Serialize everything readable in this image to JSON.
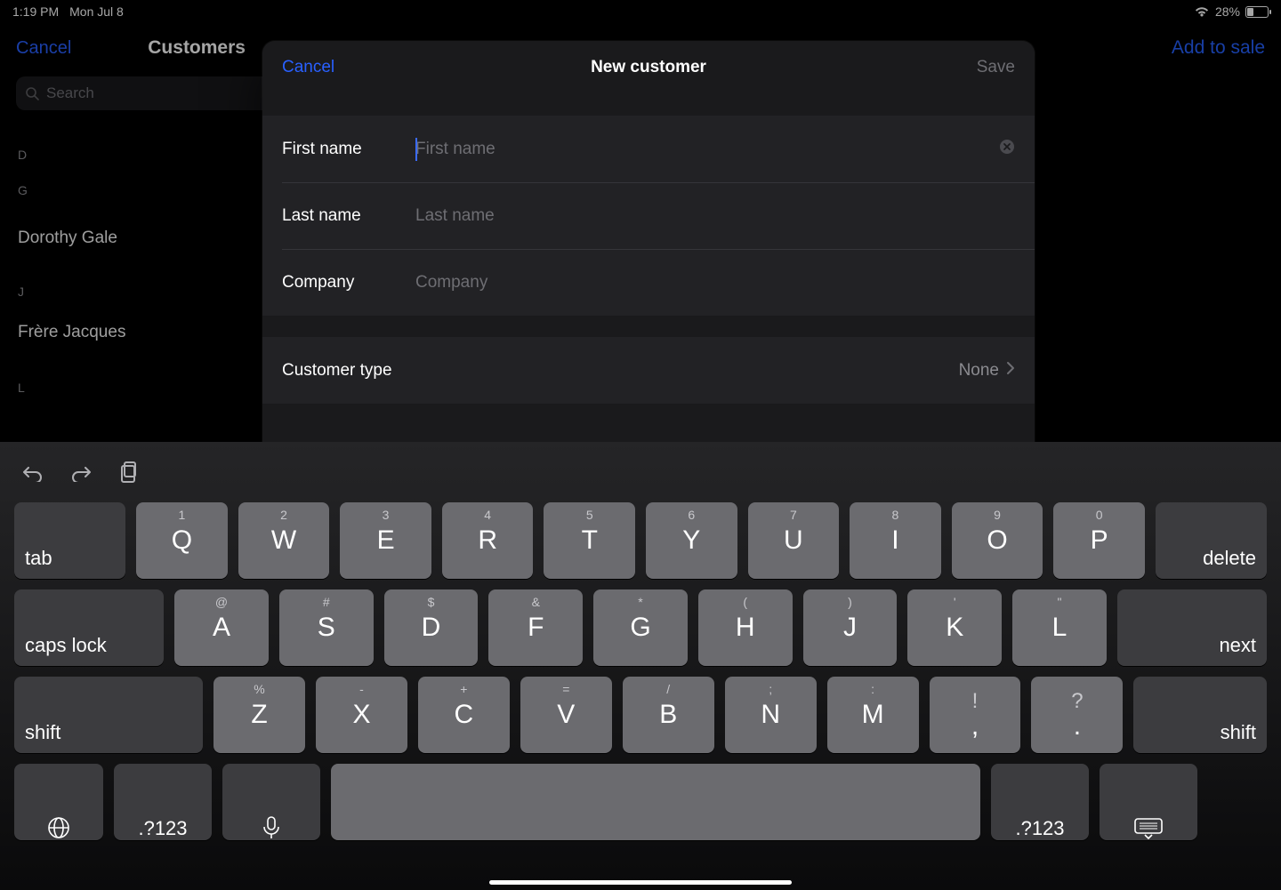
{
  "status": {
    "time": "1:19 PM",
    "date": "Mon Jul 8",
    "battery_pct": "28%"
  },
  "toolbar": {
    "cancel": "Cancel",
    "title": "Customers",
    "add": "Add to sale"
  },
  "search": {
    "placeholder": "Search"
  },
  "sections": {
    "d": "D",
    "g": "G",
    "j": "J",
    "l": "L"
  },
  "customers": {
    "dorothy": "Dorothy Gale",
    "frere": "Frère Jacques"
  },
  "modal": {
    "cancel": "Cancel",
    "title": "New customer",
    "save": "Save",
    "first_label": "First name",
    "first_ph": "First name",
    "last_label": "Last name",
    "last_ph": "Last name",
    "company_label": "Company",
    "company_ph": "Company",
    "ctype_label": "Customer type",
    "ctype_value": "None"
  },
  "keys": {
    "tab": "tab",
    "delete": "delete",
    "caps": "caps lock",
    "next": "next",
    "shift": "shift",
    "numsym": ".?123",
    "r1": [
      {
        "main": "Q",
        "hint": "1"
      },
      {
        "main": "W",
        "hint": "2"
      },
      {
        "main": "E",
        "hint": "3"
      },
      {
        "main": "R",
        "hint": "4"
      },
      {
        "main": "T",
        "hint": "5"
      },
      {
        "main": "Y",
        "hint": "6"
      },
      {
        "main": "U",
        "hint": "7"
      },
      {
        "main": "I",
        "hint": "8"
      },
      {
        "main": "O",
        "hint": "9"
      },
      {
        "main": "P",
        "hint": "0"
      }
    ],
    "r2": [
      {
        "main": "A",
        "hint": "@"
      },
      {
        "main": "S",
        "hint": "#"
      },
      {
        "main": "D",
        "hint": "$"
      },
      {
        "main": "F",
        "hint": "&"
      },
      {
        "main": "G",
        "hint": "*"
      },
      {
        "main": "H",
        "hint": "("
      },
      {
        "main": "J",
        "hint": ")"
      },
      {
        "main": "K",
        "hint": "'"
      },
      {
        "main": "L",
        "hint": "\""
      }
    ],
    "r3": [
      {
        "main": "Z",
        "hint": "%"
      },
      {
        "main": "X",
        "hint": "-"
      },
      {
        "main": "C",
        "hint": "+"
      },
      {
        "main": "V",
        "hint": "="
      },
      {
        "main": "B",
        "hint": "/"
      },
      {
        "main": "N",
        "hint": ";"
      },
      {
        "main": "M",
        "hint": ":"
      },
      {
        "main": ",",
        "hint": "!",
        "big": true
      },
      {
        "main": ".",
        "hint": "?",
        "big": true
      }
    ]
  }
}
